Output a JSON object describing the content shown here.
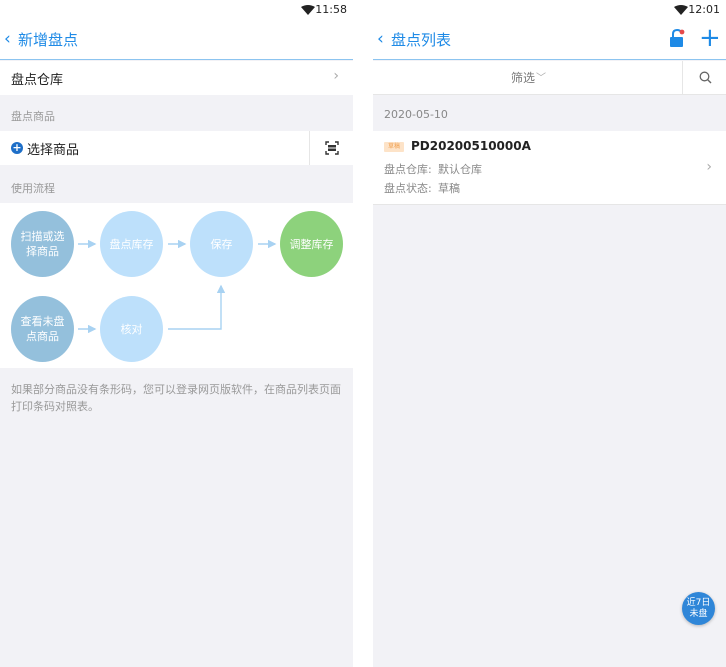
{
  "left": {
    "status_time": "11:58",
    "nav": {
      "back_glyph": "‹",
      "title": "新增盘点"
    },
    "warehouse_row": {
      "label": "盘点仓库",
      "chevron": "›"
    },
    "goods_section_label": "盘点商品",
    "select_goods": {
      "icon_glyph": "+",
      "label": "选择商品"
    },
    "flow_section_label": "使用流程",
    "flow_steps": {
      "scan": "扫描或选择商品",
      "inventory": "盘点库存",
      "save": "保存",
      "adjust": "调整库存",
      "view_unchecked": "查看未盘点商品",
      "verify": "核对"
    },
    "tip": "如果部分商品没有条形码，您可以登录网页版软件，在商品列表页面打印条码对照表。"
  },
  "right": {
    "status_time": "12:01",
    "nav": {
      "back_glyph": "‹",
      "title": "盘点列表",
      "add_glyph": "+"
    },
    "filter": {
      "label": "筛选",
      "caret": "﹀"
    },
    "date_group": "2020-05-10",
    "record": {
      "badge": "草稿",
      "code": "PD20200510000A",
      "warehouse_label": "盘点仓库:",
      "warehouse_value": "默认仓库",
      "status_label": "盘点状态:",
      "status_value": "草稿",
      "chevron": "›"
    },
    "float_button": {
      "line1": "近7日",
      "line2": "未盘"
    }
  },
  "colors": {
    "accent_blue": "#1e8ae6",
    "node_dark": "#94c0dc",
    "node_light": "#bde0fb",
    "node_green": "#8dd27c",
    "badge_orange": "#f0a050",
    "background": "#f2f2f6"
  },
  "icons": {
    "wifi": "wifi-icon",
    "back": "chevron-left-icon",
    "forward": "chevron-right-icon",
    "add_goods": "plus-circle-icon",
    "scan": "barcode-scan-icon",
    "search": "search-icon",
    "add": "plus-icon",
    "lock": "unlock-icon",
    "filter_caret": "chevron-down-icon"
  }
}
